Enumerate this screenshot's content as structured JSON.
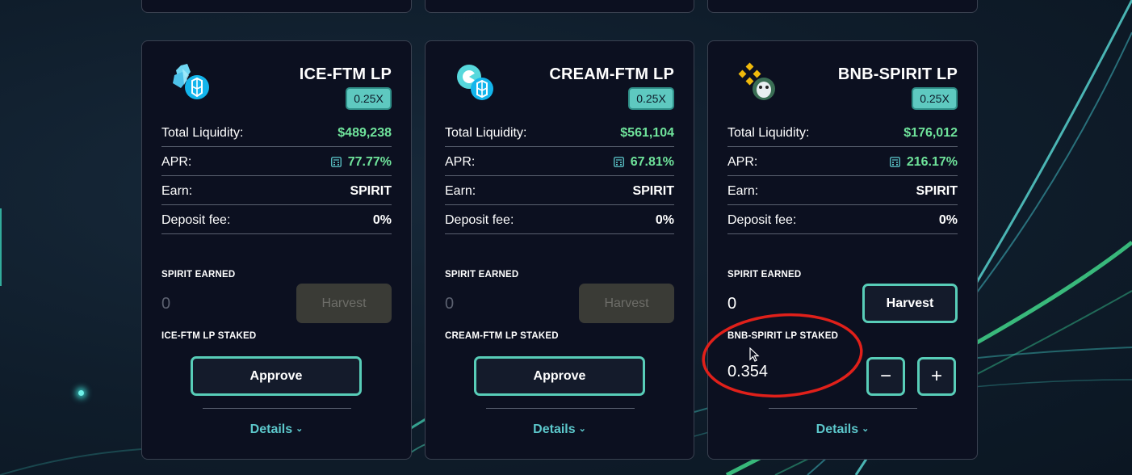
{
  "farms": [
    {
      "name": "ICE-FTM LP",
      "multiplier": "0.25X",
      "total_liquidity_label": "Total Liquidity:",
      "total_liquidity": "$489,238",
      "apr_label": "APR:",
      "apr": "77.77%",
      "earn_label": "Earn:",
      "earn": "SPIRIT",
      "deposit_fee_label": "Deposit fee:",
      "deposit_fee": "0%",
      "earned_label": "SPIRIT EARNED",
      "earned_value": "0",
      "harvest_label": "Harvest",
      "staked_label": "ICE-FTM LP STAKED",
      "approve_label": "Approve",
      "details_label": "Details",
      "logo_icon": "ice-ftm-logo-icon"
    },
    {
      "name": "CREAM-FTM LP",
      "multiplier": "0.25X",
      "total_liquidity_label": "Total Liquidity:",
      "total_liquidity": "$561,104",
      "apr_label": "APR:",
      "apr": "67.81%",
      "earn_label": "Earn:",
      "earn": "SPIRIT",
      "deposit_fee_label": "Deposit fee:",
      "deposit_fee": "0%",
      "earned_label": "SPIRIT EARNED",
      "earned_value": "0",
      "harvest_label": "Harvest",
      "staked_label": "CREAM-FTM LP STAKED",
      "approve_label": "Approve",
      "details_label": "Details",
      "logo_icon": "cream-ftm-logo-icon"
    },
    {
      "name": "BNB-SPIRIT LP",
      "multiplier": "0.25X",
      "total_liquidity_label": "Total Liquidity:",
      "total_liquidity": "$176,012",
      "apr_label": "APR:",
      "apr": "216.17%",
      "earn_label": "Earn:",
      "earn": "SPIRIT",
      "deposit_fee_label": "Deposit fee:",
      "deposit_fee": "0%",
      "earned_label": "SPIRIT EARNED",
      "earned_value": "0",
      "harvest_label": "Harvest",
      "staked_label": "BNB-SPIRIT LP STAKED",
      "staked_value": "0.354",
      "minus_label": "−",
      "plus_label": "+",
      "details_label": "Details",
      "logo_icon": "bnb-spirit-logo-icon"
    }
  ],
  "colors": {
    "accent": "#58cdb8",
    "positive": "#6fe39b",
    "link": "#5cc7cb",
    "card_bg": "#0c1020",
    "annotation": "#e0201a"
  },
  "icons": [
    "calculator-icon",
    "chevron-down-icon",
    "mouse-cursor-icon"
  ]
}
